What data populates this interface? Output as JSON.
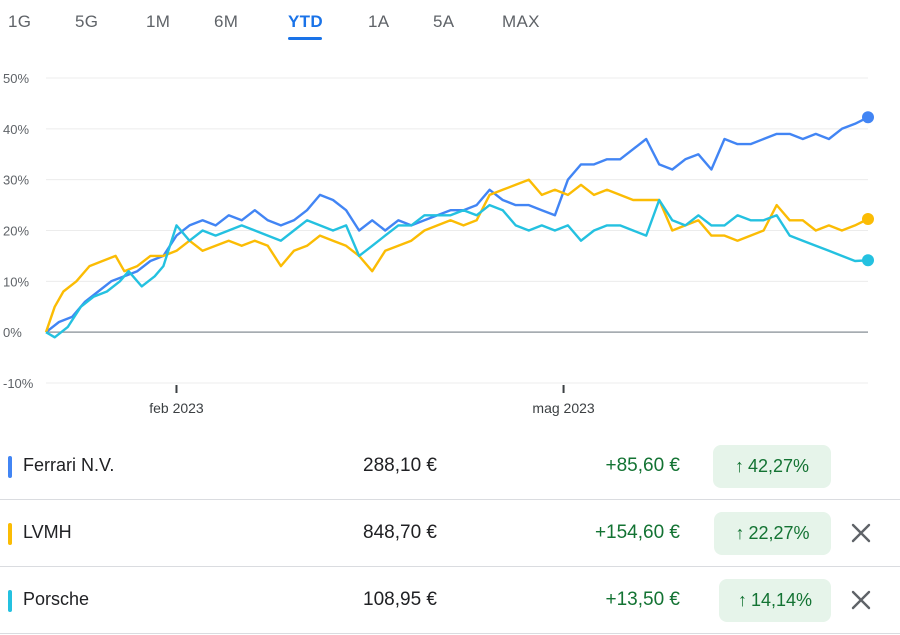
{
  "tabs": [
    {
      "label": "1G",
      "active": false
    },
    {
      "label": "5G",
      "active": false
    },
    {
      "label": "1M",
      "active": false
    },
    {
      "label": "6M",
      "active": false
    },
    {
      "label": "YTD",
      "active": true
    },
    {
      "label": "1A",
      "active": false
    },
    {
      "label": "5A",
      "active": false
    },
    {
      "label": "MAX",
      "active": false
    }
  ],
  "chart_data": {
    "type": "line",
    "title": "",
    "xlabel": "",
    "ylabel": "",
    "ylim": [
      -10,
      50
    ],
    "yticks": [
      "50%",
      "40%",
      "30%",
      "20%",
      "10%",
      "0%",
      "-10%"
    ],
    "x_range": [
      "2023-01-02",
      "2023-07-10"
    ],
    "xtick_labels": [
      {
        "date": "2023-02-01",
        "label": "feb 2023"
      },
      {
        "date": "2023-05-01",
        "label": "mag 2023"
      }
    ],
    "grid": true,
    "series": [
      {
        "name": "Ferrari N.V.",
        "color": "#4285f4",
        "points": [
          [
            "2023-01-02",
            0
          ],
          [
            "2023-01-05",
            2
          ],
          [
            "2023-01-08",
            3
          ],
          [
            "2023-01-11",
            6
          ],
          [
            "2023-01-14",
            8
          ],
          [
            "2023-01-17",
            10
          ],
          [
            "2023-01-20",
            11
          ],
          [
            "2023-01-23",
            12
          ],
          [
            "2023-01-26",
            14
          ],
          [
            "2023-01-29",
            15
          ],
          [
            "2023-02-01",
            19
          ],
          [
            "2023-02-04",
            21
          ],
          [
            "2023-02-07",
            22
          ],
          [
            "2023-02-10",
            21
          ],
          [
            "2023-02-13",
            23
          ],
          [
            "2023-02-16",
            22
          ],
          [
            "2023-02-19",
            24
          ],
          [
            "2023-02-22",
            22
          ],
          [
            "2023-02-25",
            21
          ],
          [
            "2023-02-28",
            22
          ],
          [
            "2023-03-03",
            24
          ],
          [
            "2023-03-06",
            27
          ],
          [
            "2023-03-09",
            26
          ],
          [
            "2023-03-12",
            24
          ],
          [
            "2023-03-15",
            20
          ],
          [
            "2023-03-18",
            22
          ],
          [
            "2023-03-21",
            20
          ],
          [
            "2023-03-24",
            22
          ],
          [
            "2023-03-27",
            21
          ],
          [
            "2023-03-30",
            22
          ],
          [
            "2023-04-02",
            23
          ],
          [
            "2023-04-05",
            24
          ],
          [
            "2023-04-08",
            24
          ],
          [
            "2023-04-11",
            25
          ],
          [
            "2023-04-14",
            28
          ],
          [
            "2023-04-17",
            26
          ],
          [
            "2023-04-20",
            25
          ],
          [
            "2023-04-23",
            25
          ],
          [
            "2023-04-26",
            24
          ],
          [
            "2023-04-29",
            23
          ],
          [
            "2023-05-02",
            30
          ],
          [
            "2023-05-05",
            33
          ],
          [
            "2023-05-08",
            33
          ],
          [
            "2023-05-11",
            34
          ],
          [
            "2023-05-14",
            34
          ],
          [
            "2023-05-17",
            36
          ],
          [
            "2023-05-20",
            38
          ],
          [
            "2023-05-23",
            33
          ],
          [
            "2023-05-26",
            32
          ],
          [
            "2023-05-29",
            34
          ],
          [
            "2023-06-01",
            35
          ],
          [
            "2023-06-04",
            32
          ],
          [
            "2023-06-07",
            38
          ],
          [
            "2023-06-10",
            37
          ],
          [
            "2023-06-13",
            37
          ],
          [
            "2023-06-16",
            38
          ],
          [
            "2023-06-19",
            39
          ],
          [
            "2023-06-22",
            39
          ],
          [
            "2023-06-25",
            38
          ],
          [
            "2023-06-28",
            39
          ],
          [
            "2023-07-01",
            38
          ],
          [
            "2023-07-04",
            40
          ],
          [
            "2023-07-07",
            41
          ],
          [
            "2023-07-10",
            42.27
          ]
        ]
      },
      {
        "name": "LVMH",
        "color": "#fbbc04",
        "points": [
          [
            "2023-01-02",
            0
          ],
          [
            "2023-01-04",
            5
          ],
          [
            "2023-01-06",
            8
          ],
          [
            "2023-01-09",
            10
          ],
          [
            "2023-01-12",
            13
          ],
          [
            "2023-01-15",
            14
          ],
          [
            "2023-01-18",
            15
          ],
          [
            "2023-01-20",
            12
          ],
          [
            "2023-01-23",
            13
          ],
          [
            "2023-01-26",
            15
          ],
          [
            "2023-01-29",
            15
          ],
          [
            "2023-02-01",
            16
          ],
          [
            "2023-02-04",
            18
          ],
          [
            "2023-02-07",
            16
          ],
          [
            "2023-02-10",
            17
          ],
          [
            "2023-02-13",
            18
          ],
          [
            "2023-02-16",
            17
          ],
          [
            "2023-02-19",
            18
          ],
          [
            "2023-02-22",
            17
          ],
          [
            "2023-02-25",
            13
          ],
          [
            "2023-02-28",
            16
          ],
          [
            "2023-03-03",
            17
          ],
          [
            "2023-03-06",
            19
          ],
          [
            "2023-03-09",
            18
          ],
          [
            "2023-03-12",
            17
          ],
          [
            "2023-03-15",
            15
          ],
          [
            "2023-03-18",
            12
          ],
          [
            "2023-03-21",
            16
          ],
          [
            "2023-03-24",
            17
          ],
          [
            "2023-03-27",
            18
          ],
          [
            "2023-03-30",
            20
          ],
          [
            "2023-04-02",
            21
          ],
          [
            "2023-04-05",
            22
          ],
          [
            "2023-04-08",
            21
          ],
          [
            "2023-04-11",
            22
          ],
          [
            "2023-04-14",
            27
          ],
          [
            "2023-04-17",
            28
          ],
          [
            "2023-04-20",
            29
          ],
          [
            "2023-04-23",
            30
          ],
          [
            "2023-04-26",
            27
          ],
          [
            "2023-04-29",
            28
          ],
          [
            "2023-05-02",
            27
          ],
          [
            "2023-05-05",
            29
          ],
          [
            "2023-05-08",
            27
          ],
          [
            "2023-05-11",
            28
          ],
          [
            "2023-05-14",
            27
          ],
          [
            "2023-05-17",
            26
          ],
          [
            "2023-05-20",
            26
          ],
          [
            "2023-05-23",
            26
          ],
          [
            "2023-05-26",
            20
          ],
          [
            "2023-05-29",
            21
          ],
          [
            "2023-06-01",
            22
          ],
          [
            "2023-06-04",
            19
          ],
          [
            "2023-06-07",
            19
          ],
          [
            "2023-06-10",
            18
          ],
          [
            "2023-06-13",
            19
          ],
          [
            "2023-06-16",
            20
          ],
          [
            "2023-06-19",
            25
          ],
          [
            "2023-06-22",
            22
          ],
          [
            "2023-06-25",
            22
          ],
          [
            "2023-06-28",
            20
          ],
          [
            "2023-07-01",
            21
          ],
          [
            "2023-07-04",
            20
          ],
          [
            "2023-07-07",
            21
          ],
          [
            "2023-07-10",
            22.27
          ]
        ]
      },
      {
        "name": "Porsche",
        "color": "#24c1e0",
        "points": [
          [
            "2023-01-02",
            0
          ],
          [
            "2023-01-04",
            -1
          ],
          [
            "2023-01-07",
            1
          ],
          [
            "2023-01-10",
            5
          ],
          [
            "2023-01-13",
            7
          ],
          [
            "2023-01-16",
            8
          ],
          [
            "2023-01-19",
            10
          ],
          [
            "2023-01-21",
            12
          ],
          [
            "2023-01-24",
            9
          ],
          [
            "2023-01-27",
            11
          ],
          [
            "2023-01-29",
            13
          ],
          [
            "2023-02-01",
            21
          ],
          [
            "2023-02-04",
            18
          ],
          [
            "2023-02-07",
            20
          ],
          [
            "2023-02-10",
            19
          ],
          [
            "2023-02-13",
            20
          ],
          [
            "2023-02-16",
            21
          ],
          [
            "2023-02-19",
            20
          ],
          [
            "2023-02-22",
            19
          ],
          [
            "2023-02-25",
            18
          ],
          [
            "2023-02-28",
            20
          ],
          [
            "2023-03-03",
            22
          ],
          [
            "2023-03-06",
            21
          ],
          [
            "2023-03-09",
            20
          ],
          [
            "2023-03-12",
            21
          ],
          [
            "2023-03-15",
            15
          ],
          [
            "2023-03-18",
            17
          ],
          [
            "2023-03-21",
            19
          ],
          [
            "2023-03-24",
            21
          ],
          [
            "2023-03-27",
            21
          ],
          [
            "2023-03-30",
            23
          ],
          [
            "2023-04-02",
            23
          ],
          [
            "2023-04-05",
            23
          ],
          [
            "2023-04-08",
            24
          ],
          [
            "2023-04-11",
            23
          ],
          [
            "2023-04-14",
            25
          ],
          [
            "2023-04-17",
            24
          ],
          [
            "2023-04-20",
            21
          ],
          [
            "2023-04-23",
            20
          ],
          [
            "2023-04-26",
            21
          ],
          [
            "2023-04-29",
            20
          ],
          [
            "2023-05-02",
            21
          ],
          [
            "2023-05-05",
            18
          ],
          [
            "2023-05-08",
            20
          ],
          [
            "2023-05-11",
            21
          ],
          [
            "2023-05-14",
            21
          ],
          [
            "2023-05-17",
            20
          ],
          [
            "2023-05-20",
            19
          ],
          [
            "2023-05-23",
            26
          ],
          [
            "2023-05-26",
            22
          ],
          [
            "2023-05-29",
            21
          ],
          [
            "2023-06-01",
            23
          ],
          [
            "2023-06-04",
            21
          ],
          [
            "2023-06-07",
            21
          ],
          [
            "2023-06-10",
            23
          ],
          [
            "2023-06-13",
            22
          ],
          [
            "2023-06-16",
            22
          ],
          [
            "2023-06-19",
            23
          ],
          [
            "2023-06-22",
            19
          ],
          [
            "2023-06-25",
            18
          ],
          [
            "2023-06-28",
            17
          ],
          [
            "2023-07-01",
            16
          ],
          [
            "2023-07-04",
            15
          ],
          [
            "2023-07-07",
            14
          ],
          [
            "2023-07-10",
            14.14
          ]
        ]
      }
    ]
  },
  "holdings": [
    {
      "name": "Ferrari N.V.",
      "color": "#4285f4",
      "price": "288,10 €",
      "change": "+85,60 €",
      "pct": "42,27%",
      "removable": false
    },
    {
      "name": "LVMH",
      "color": "#fbbc04",
      "price": "848,70 €",
      "change": "+154,60 €",
      "pct": "22,27%",
      "removable": true
    },
    {
      "name": "Porsche",
      "color": "#24c1e0",
      "price": "108,95 €",
      "change": "+13,50 €",
      "pct": "14,14%",
      "removable": true
    }
  ],
  "icons": {
    "trend": "arrow-up-icon",
    "remove": "close-icon"
  }
}
